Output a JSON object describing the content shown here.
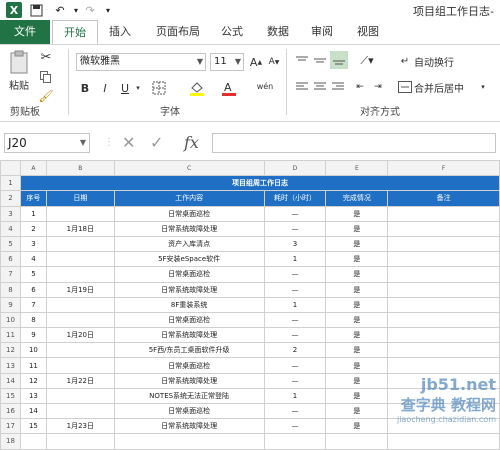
{
  "titlebar": {
    "title": "项目组工作日志-"
  },
  "tabs": [
    {
      "label": "文件"
    },
    {
      "label": "开始"
    },
    {
      "label": "插入"
    },
    {
      "label": "页面布局"
    },
    {
      "label": "公式"
    },
    {
      "label": "数据"
    },
    {
      "label": "审阅"
    },
    {
      "label": "视图"
    }
  ],
  "ribbon": {
    "clipboard": {
      "paste_label": "粘贴",
      "group_label": "剪贴板"
    },
    "font": {
      "name": "微软雅黑",
      "size": "11",
      "group_label": "字体",
      "bold": "B",
      "italic": "I",
      "underline": "U",
      "phonetic": "wén"
    },
    "alignment": {
      "wrap_label": "自动换行",
      "merge_label": "合并后居中",
      "group_label": "对齐方式"
    }
  },
  "formula_bar": {
    "cell_ref": "J20",
    "fx": "fx",
    "value": ""
  },
  "sheet": {
    "columns": [
      "A",
      "B",
      "C",
      "D",
      "E",
      "F"
    ],
    "title": "项目组周工作日志",
    "headers": [
      "序号",
      "日期",
      "工作内容",
      "耗时（小时）",
      "完成情况",
      "备注"
    ],
    "rows": [
      {
        "n": "1",
        "date": "",
        "task": "日常桌面巡检",
        "hours": "—",
        "done": "是"
      },
      {
        "n": "2",
        "date": "1月18日",
        "task": "日常系统故障处理",
        "hours": "—",
        "done": "是"
      },
      {
        "n": "3",
        "date": "",
        "task": "资产入库清点",
        "hours": "3",
        "done": "是"
      },
      {
        "n": "4",
        "date": "",
        "task": "5F安装eSpace软件",
        "hours": "1",
        "done": "是"
      },
      {
        "n": "5",
        "date": "",
        "task": "日常桌面巡检",
        "hours": "—",
        "done": "是"
      },
      {
        "n": "6",
        "date": "1月19日",
        "task": "日常系统故障处理",
        "hours": "—",
        "done": "是"
      },
      {
        "n": "7",
        "date": "",
        "task": "8F重装系统",
        "hours": "1",
        "done": "是"
      },
      {
        "n": "8",
        "date": "",
        "task": "日常桌面巡检",
        "hours": "—",
        "done": "是"
      },
      {
        "n": "9",
        "date": "1月20日",
        "task": "日常系统故障处理",
        "hours": "—",
        "done": "是"
      },
      {
        "n": "10",
        "date": "",
        "task": "5F西/东员工桌面软件升级",
        "hours": "2",
        "done": "是"
      },
      {
        "n": "11",
        "date": "",
        "task": "日常桌面巡检",
        "hours": "—",
        "done": "是"
      },
      {
        "n": "12",
        "date": "1月22日",
        "task": "日常系统故障处理",
        "hours": "—",
        "done": "是"
      },
      {
        "n": "13",
        "date": "",
        "task": "NOTES系统无法正常登陆",
        "hours": "1",
        "done": "是"
      },
      {
        "n": "14",
        "date": "",
        "task": "日常桌面巡检",
        "hours": "—",
        "done": "是"
      },
      {
        "n": "15",
        "date": "1月23日",
        "task": "日常系统故障处理",
        "hours": "—",
        "done": "是"
      }
    ],
    "row_numbers": [
      "1",
      "2",
      "3",
      "4",
      "5",
      "6",
      "7",
      "8",
      "9",
      "10",
      "11",
      "12",
      "13",
      "14",
      "15",
      "16",
      "17",
      "18"
    ]
  },
  "watermark": {
    "line1": "jb51.net",
    "line2": "查字典 教程网",
    "line3": "jiaocheng.chazidian.com"
  }
}
